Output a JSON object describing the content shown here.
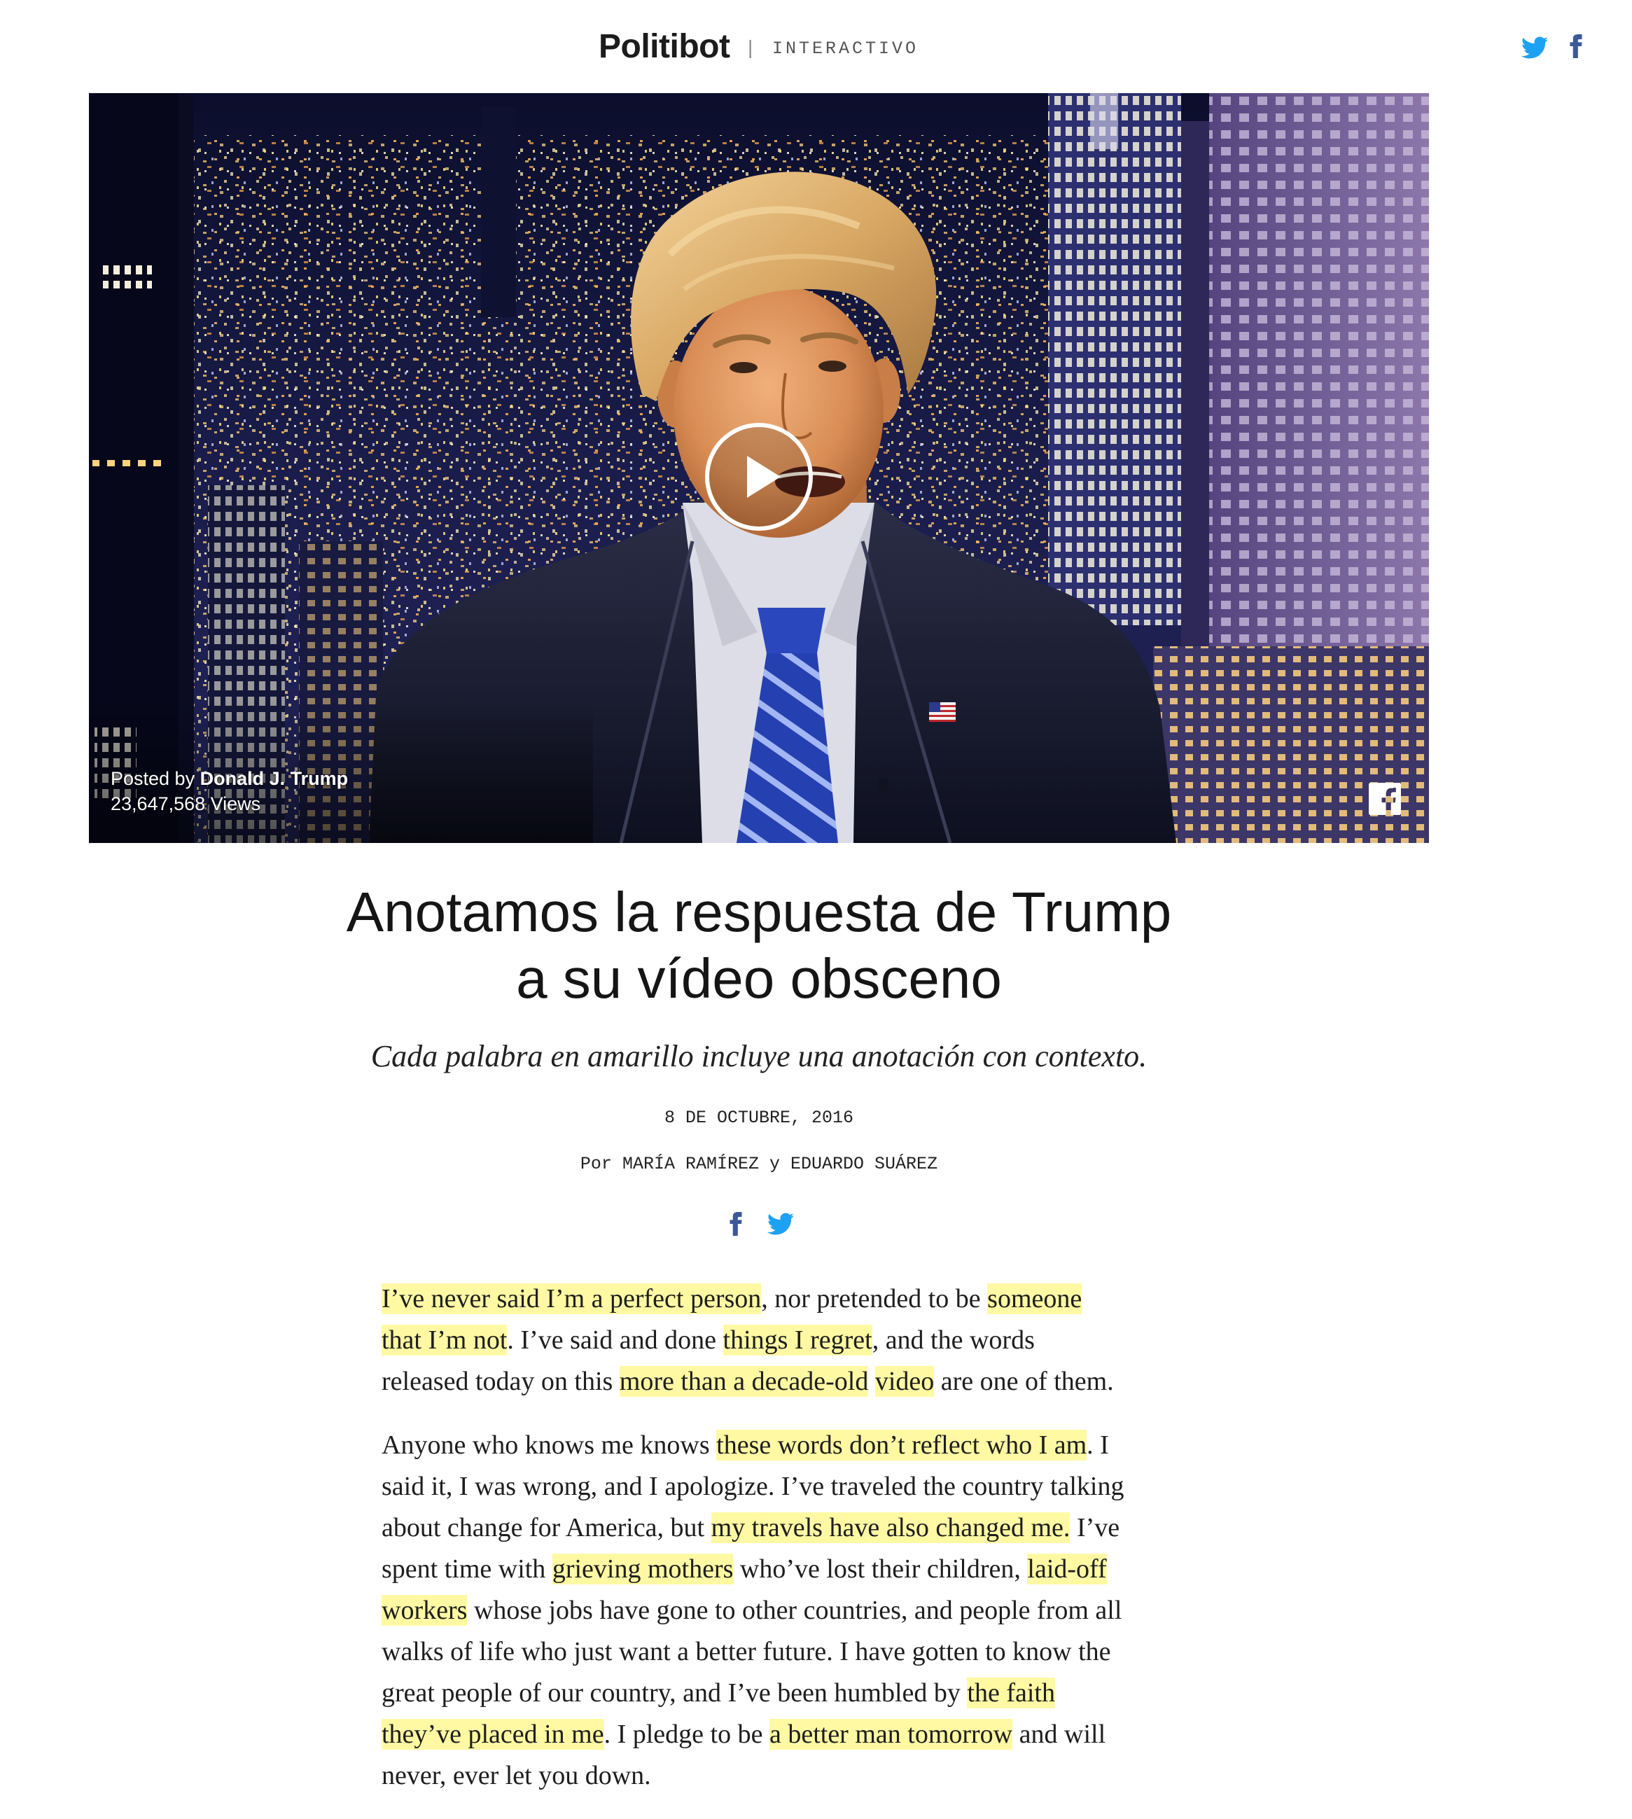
{
  "header": {
    "brand": "Politibot",
    "separator": "|",
    "section": "INTERACTIVO",
    "share_icons": [
      "twitter-icon",
      "facebook-icon"
    ]
  },
  "video": {
    "posted_by_label": "Posted by",
    "author": "Donald J. Trump",
    "views": "23,647,568 Views",
    "overlay_icons": [
      "play-icon",
      "facebook-square-icon"
    ]
  },
  "article": {
    "title_lines": [
      "Anotamos la respuesta de Trump",
      "a su vídeo obsceno"
    ],
    "subtitle": "Cada palabra en amarillo incluye una anotación con contexto.",
    "date": "8 DE OCTUBRE, 2016",
    "byline": {
      "prefix": "Por",
      "author_1": "MARÍA RAMÍREZ",
      "conjunction": "y",
      "author_2": "EDUARDO SUÁREZ"
    },
    "share_icons": [
      "facebook-icon",
      "twitter-icon"
    ]
  },
  "body": {
    "paragraphs": [
      {
        "lines": [
          [
            {
              "text": "I’ve never said I’m a perfect person",
              "highlight": true
            },
            {
              "text": ", nor pretended to be "
            },
            {
              "text": "someone",
              "highlight": true
            }
          ],
          [
            {
              "text": "that I’m not",
              "highlight": true
            },
            {
              "text": ". I’ve said and done "
            },
            {
              "text": "things I regret",
              "highlight": true
            },
            {
              "text": ", and the words"
            }
          ],
          [
            {
              "text": "released today on this "
            },
            {
              "text": "more than a decade-old",
              "highlight": true
            },
            {
              "text": " "
            },
            {
              "text": "video",
              "highlight": true
            },
            {
              "text": " are one of them."
            }
          ]
        ]
      },
      {
        "lines": [
          [
            {
              "text": "Anyone who knows me knows "
            },
            {
              "text": "these words don’t reflect who I am",
              "highlight": true
            },
            {
              "text": ". I"
            }
          ],
          [
            {
              "text": "said it, I was wrong, and I apologize. I’ve traveled the country talking"
            }
          ],
          [
            {
              "text": "about change for America, but "
            },
            {
              "text": "my travels have also changed me.",
              "highlight": true
            },
            {
              "text": " I’ve"
            }
          ],
          [
            {
              "text": "spent time with "
            },
            {
              "text": "grieving mothers",
              "highlight": true
            },
            {
              "text": " who’ve lost their children, "
            },
            {
              "text": "laid-off",
              "highlight": true
            }
          ],
          [
            {
              "text": "workers",
              "highlight": true
            },
            {
              "text": " whose jobs have gone to other countries, and people from all"
            }
          ],
          [
            {
              "text": "walks of life who just want a better future. I have gotten to know the"
            }
          ],
          [
            {
              "text": "great people of our country, and I’ve been humbled by "
            },
            {
              "text": "the faith",
              "highlight": true
            }
          ],
          [
            {
              "text": "they’ve placed in me",
              "highlight": true
            },
            {
              "text": ". I pledge to be "
            },
            {
              "text": "a better man tomorrow",
              "highlight": true
            },
            {
              "text": " and will"
            }
          ],
          [
            {
              "text": "never, ever let you down."
            }
          ]
        ]
      }
    ]
  },
  "colors": {
    "highlight": "#fff9a3",
    "twitter": "#1da1f2",
    "facebook": "#3b5998",
    "text": "#1e1e1e"
  }
}
